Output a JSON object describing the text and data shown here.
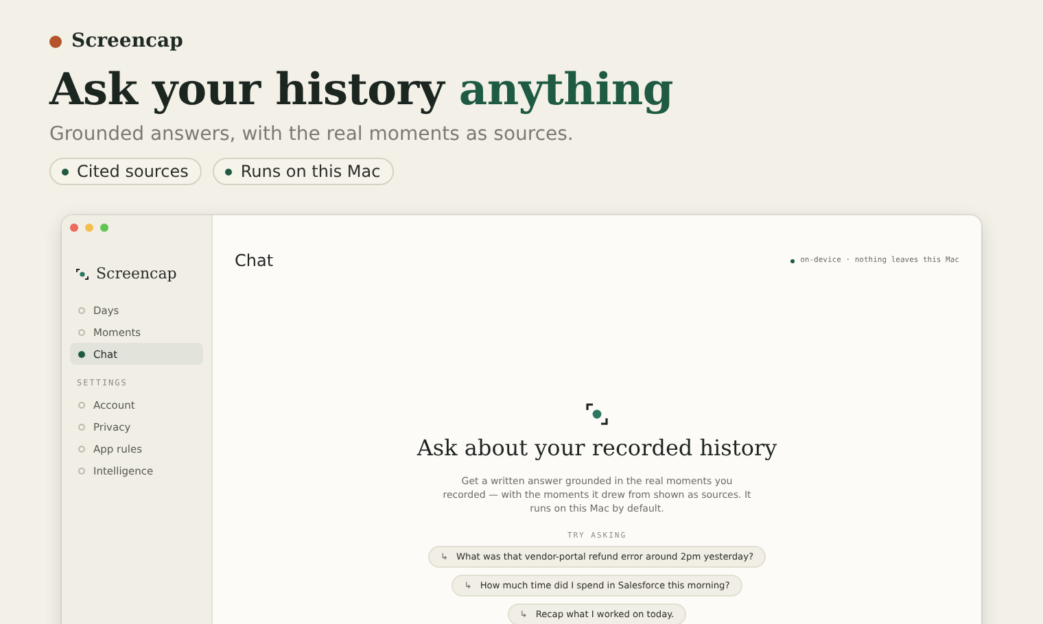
{
  "brand": {
    "name": "Screencap"
  },
  "headline": {
    "text": "Ask your history",
    "accent": "anything"
  },
  "subtitle": "Grounded answers, with the real moments as sources.",
  "chips": [
    "Cited sources",
    "Runs on this Mac"
  ],
  "window": {
    "sidebar": {
      "title": "Screencap",
      "items": [
        {
          "label": "Days",
          "selected": false
        },
        {
          "label": "Moments",
          "selected": false
        },
        {
          "label": "Chat",
          "selected": true
        }
      ],
      "section": "SETTINGS",
      "settings": [
        {
          "label": "Account",
          "selected": false
        },
        {
          "label": "Privacy",
          "selected": false
        },
        {
          "label": "App rules",
          "selected": false
        },
        {
          "label": "Intelligence",
          "selected": false
        }
      ]
    },
    "main": {
      "title": "Chat",
      "status": "on-device · nothing leaves this Mac",
      "empty_title": "Ask about your recorded history",
      "empty_text": "Get a written answer grounded in the real moments you recorded — with the moments it drew from shown as sources. It runs on this Mac by default.",
      "try_label": "TRY ASKING",
      "suggestions": [
        {
          "icon": "↳",
          "text": "What was that vendor-portal refund error around 2pm yesterday?"
        },
        {
          "icon": "↳",
          "text": "How much time did I spend in Salesforce this morning?"
        },
        {
          "icon": "↳",
          "text": "Recap what I worked on today."
        }
      ]
    }
  }
}
